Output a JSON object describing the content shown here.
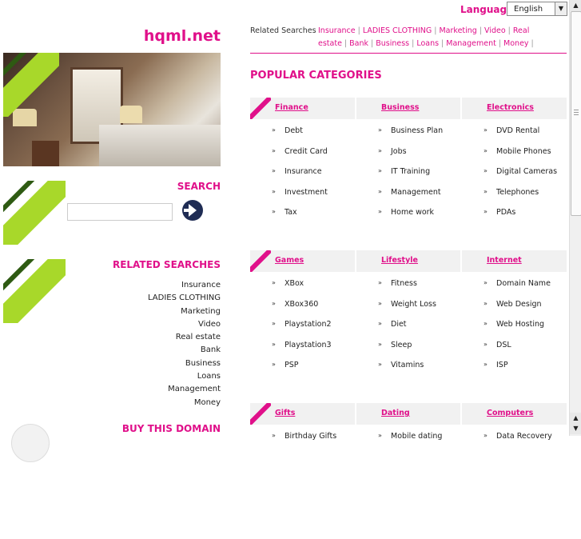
{
  "language": {
    "label": "Language:",
    "selected": "English"
  },
  "site_title": "hqml.net",
  "left": {
    "search_heading": "SEARCH",
    "related_heading": "RELATED SEARCHES",
    "related_items": [
      "Insurance",
      "LADIES CLOTHING",
      "Marketing",
      "Video",
      "Real estate",
      "Bank",
      "Business",
      "Loans",
      "Management",
      "Money"
    ],
    "buy_heading": "BUY THIS DOMAIN"
  },
  "top_related": {
    "label": "Related Searches",
    "links": [
      "Insurance",
      "LADIES CLOTHING",
      "Marketing",
      "Video",
      "Real estate",
      "Bank",
      "Business",
      "Loans",
      "Management",
      "Money"
    ]
  },
  "popular_title": "POPULAR CATEGORIES",
  "categories": [
    {
      "columns": [
        {
          "heading": "Finance",
          "items": [
            "Debt",
            "Credit Card",
            "Insurance",
            "Investment",
            "Tax"
          ]
        },
        {
          "heading": "Business",
          "items": [
            "Business Plan",
            "Jobs",
            "IT Training",
            "Management",
            "Home work"
          ]
        },
        {
          "heading": "Electronics",
          "items": [
            "DVD Rental",
            "Mobile Phones",
            "Digital Cameras",
            "Telephones",
            "PDAs"
          ]
        }
      ]
    },
    {
      "columns": [
        {
          "heading": "Games",
          "items": [
            "XBox",
            "XBox360",
            "Playstation2",
            "Playstation3",
            "PSP"
          ]
        },
        {
          "heading": "Lifestyle",
          "items": [
            "Fitness",
            "Weight Loss",
            "Diet",
            "Sleep",
            "Vitamins"
          ]
        },
        {
          "heading": "Internet",
          "items": [
            "Domain Name",
            "Web Design",
            "Web Hosting",
            "DSL",
            "ISP"
          ]
        }
      ]
    },
    {
      "columns": [
        {
          "heading": "Gifts",
          "items": [
            "Birthday Gifts"
          ]
        },
        {
          "heading": "Dating",
          "items": [
            "Mobile dating"
          ]
        },
        {
          "heading": "Computers",
          "items": [
            "Data Recovery"
          ]
        }
      ]
    }
  ],
  "colors": {
    "accent": "#e0108a",
    "stripe_green": "#a8d82a",
    "stripe_dark": "#2e5a12"
  }
}
